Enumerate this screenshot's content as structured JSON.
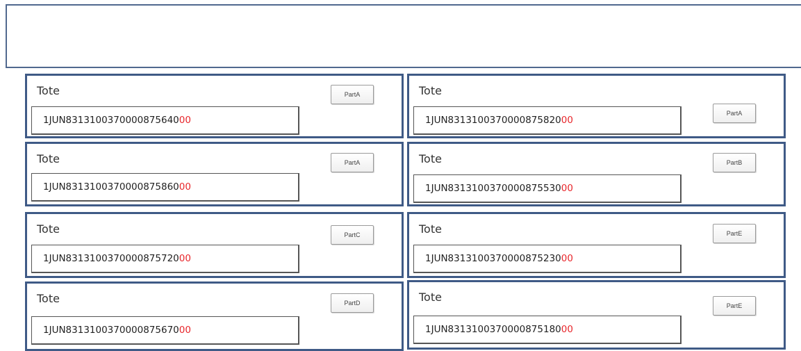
{
  "colors": {
    "border": "#3f5a86",
    "suffix": "#e8262b"
  },
  "cards": [
    {
      "label": "Tote",
      "part": "PartA",
      "code": "1JUN8313100370000875640",
      "suffix": "00"
    },
    {
      "label": "Tote",
      "part": "PartA",
      "code": "1JUN8313100370000875820",
      "suffix": "00"
    },
    {
      "label": "Tote",
      "part": "PartA",
      "code": "1JUN8313100370000875860",
      "suffix": "00"
    },
    {
      "label": "Tote",
      "part": "PartB",
      "code": "1JUN8313100370000875530",
      "suffix": "00"
    },
    {
      "label": "Tote",
      "part": "PartC",
      "code": "1JUN8313100370000875720",
      "suffix": "00"
    },
    {
      "label": "Tote",
      "part": "PartE",
      "code": "1JUN8313100370000875230",
      "suffix": "00"
    },
    {
      "label": "Tote",
      "part": "PartD",
      "code": "1JUN8313100370000875670",
      "suffix": "00"
    },
    {
      "label": "Tote",
      "part": "PartE",
      "code": "1JUN8313100370000875180",
      "suffix": "00"
    }
  ]
}
